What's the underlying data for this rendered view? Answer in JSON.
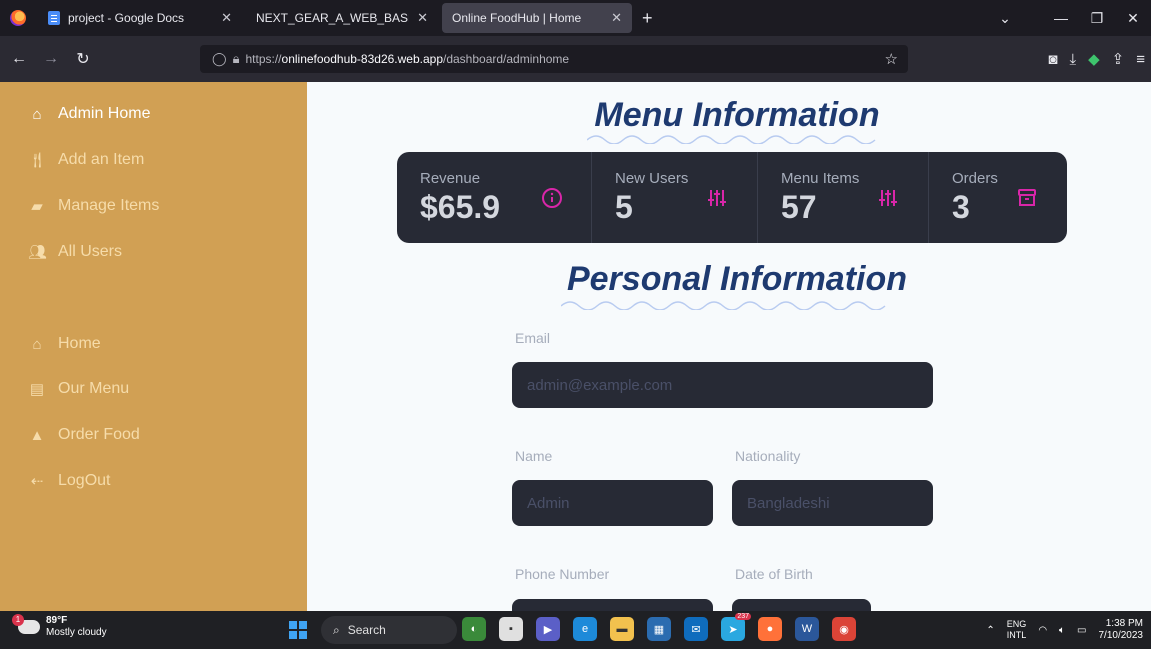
{
  "browser": {
    "tabs": [
      {
        "label": "project - Google Docs",
        "active": false
      },
      {
        "label": "NEXT_GEAR_A_WEB_BASED_APPLIC",
        "active": false
      },
      {
        "label": "Online FoodHub | Home",
        "active": true
      }
    ],
    "url_prefix": "https://",
    "url_domain": "onlinefoodhub-83d26.web.app",
    "url_path": "/dashboard/adminhome"
  },
  "sidebar": {
    "items": [
      {
        "label": "Admin Home",
        "icon": "home-icon"
      },
      {
        "label": "Add an Item",
        "icon": "utensils-icon"
      },
      {
        "label": "Manage Items",
        "icon": "wallet-icon"
      },
      {
        "label": "All Users",
        "icon": "users-icon"
      },
      {
        "label": "Home",
        "icon": "home-icon"
      },
      {
        "label": "Our Menu",
        "icon": "book-icon"
      },
      {
        "label": "Order Food",
        "icon": "bag-icon"
      },
      {
        "label": "LogOut",
        "icon": "logout-icon"
      }
    ]
  },
  "menu_heading": "Menu Information",
  "stats": [
    {
      "title": "Revenue",
      "value": "$65.9",
      "icon": "info-icon"
    },
    {
      "title": "New Users",
      "value": "5",
      "icon": "sliders-icon"
    },
    {
      "title": "Menu Items",
      "value": "57",
      "icon": "sliders-icon"
    },
    {
      "title": "Orders",
      "value": "3",
      "icon": "archive-icon"
    }
  ],
  "personal_heading": "Personal Information",
  "form": {
    "email_label": "Email",
    "email_placeholder": "admin@example.com",
    "name_label": "Name",
    "name_placeholder": "Admin",
    "nationality_label": "Nationality",
    "nationality_placeholder": "Bangladeshi",
    "phone_label": "Phone Number",
    "dob_label": "Date of Birth"
  },
  "taskbar": {
    "temperature": "89°F",
    "weather": "Mostly cloudy",
    "weather_badge": "1",
    "search_label": "Search",
    "mail_badge": "237",
    "lang_top": "ENG",
    "lang_bottom": "INTL",
    "time": "1:38 PM",
    "date": "7/10/2023"
  },
  "colors": {
    "sidebar": "#d1a054",
    "heading": "#1e3a70",
    "accent": "#d926a9",
    "stat_bg": "#272a35"
  }
}
